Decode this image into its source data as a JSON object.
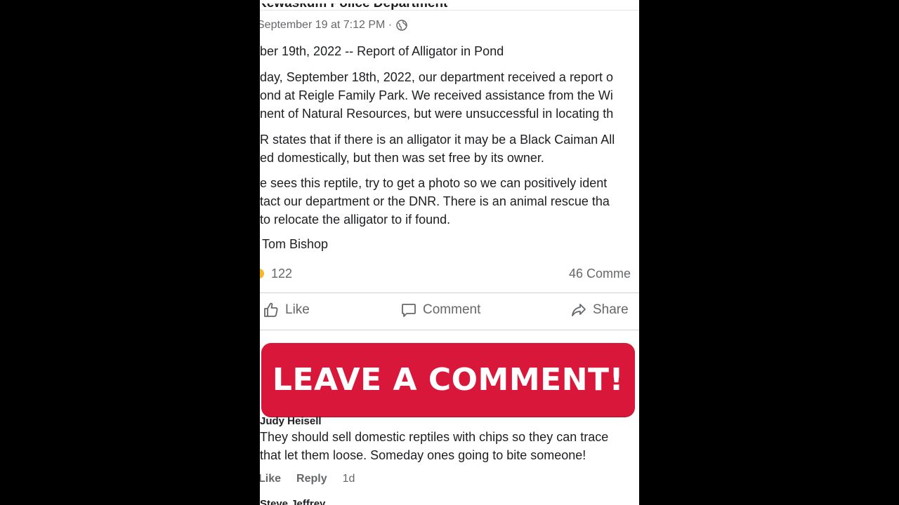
{
  "post": {
    "author": "Kewaskum Police Department",
    "timestamp": "September 19 at 7:12 PM · ",
    "title": "ber 19th, 2022 -- Report of Alligator in Pond",
    "paragraph1": [
      "day, September 18th, 2022, our department received a report o",
      "ond at Reigle Family Park.  We received assistance from the Wi",
      "nent of Natural Resources, but were unsuccessful in locating th"
    ],
    "paragraph2": [
      "R states that if there is an alligator it may be a Black Caiman All",
      "ed domestically, but then was set free by its owner."
    ],
    "paragraph3": [
      "e sees this reptile, try to get a photo so we can positively ident",
      "tact our department or the DNR.  There is an animal rescue tha",
      "to relocate the alligator to if found."
    ],
    "signoff": "Tom Bishop",
    "reactions_count": "122",
    "comments_count": "46 Comme",
    "actions": {
      "like": "Like",
      "comment": "Comment",
      "share": "Share"
    }
  },
  "banner": {
    "text": "LEAVE A COMMENT!",
    "color": "#d9173a"
  },
  "comment": {
    "author": "Judy Heisell",
    "lines": [
      "They should sell domestic reptiles with chips so they can trace",
      "that let them loose. Someday ones going to bite someone!"
    ],
    "like": "Like",
    "reply": "Reply",
    "time": "1d"
  },
  "next_comment": {
    "author": "Steve Jeffrey"
  },
  "icons": {
    "globe": "globe-icon",
    "like": "thumbs-up-icon",
    "comment": "speech-bubble-icon",
    "share": "share-arrow-icon"
  }
}
